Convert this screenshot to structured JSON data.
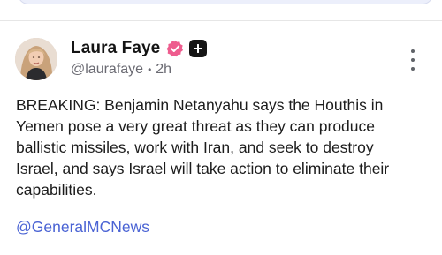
{
  "post": {
    "author": {
      "display_name": "Laura Faye",
      "handle": "@laurafaye",
      "time_ago": "2h",
      "badges": [
        "verified-badge-icon",
        "plus-badge-icon"
      ]
    },
    "body_lines": [
      "BREAKING: Benjamin Netanyahu says the Houthis in",
      "Yemen pose a very great threat as they can produce",
      "ballistic missiles, work with Iran, and seek to destroy",
      "Israel, and says Israel will take action to eliminate their",
      "capabilities."
    ],
    "mention": "@GeneralMCNews",
    "menu_icon": "more-vertical-icon"
  },
  "colors": {
    "verified_badge": "#ee5c8e",
    "plus_badge": "#151515",
    "mention_link": "#4a63d4",
    "top_card_bg": "#eceffb"
  }
}
